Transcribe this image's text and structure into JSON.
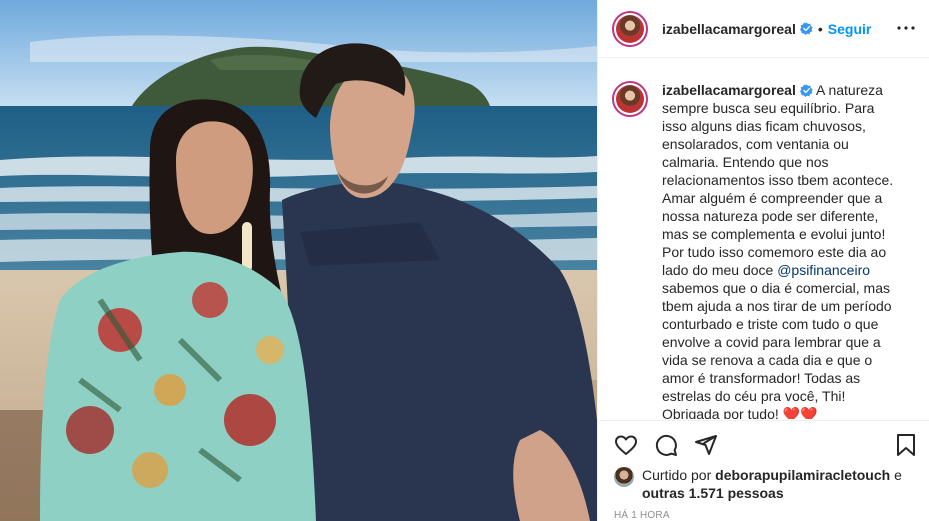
{
  "post": {
    "username": "izabellacamargoreal",
    "verified_icon": "verified-badge-icon",
    "follow_label": "Seguir",
    "dot": "•",
    "caption": "A natureza sempre busca seu equilíbrio. Para isso alguns dias ficam chuvosos, ensolarados, com ventania ou calmaria. Entendo que nos relacionamentos isso tbem acontece. Amar alguém é compreender que a nossa natureza pode ser diferente, mas se complementa e evolui junto! Por tudo isso comemoro este dia ao lado do meu doce ",
    "mention": "@psifinanceiro",
    "caption_tail": " sabemos que o dia é comercial, mas tbem ajuda a nos tirar de um período conturbado e triste com tudo o que envolve a covid para lembrar que a vida se renova a cada dia e que o amor é transformador! Todas as estrelas do céu pra você, Thi!\nObrigada por tudo! ",
    "hearts": "❤️❤️"
  },
  "likes": {
    "prefix": "Curtido por ",
    "liker": "deborapupilamiracletouch",
    "mid": " e",
    "others": "outras 1.571 pessoas"
  },
  "timestamp": "HÁ 1 HORA",
  "colors": {
    "accent": "#0095f6",
    "verified": "#3897f0",
    "text": "#262626",
    "muted": "#8e8e8e",
    "mention": "#00376b",
    "heart": "#ed4956"
  },
  "icons": [
    "more-options-icon",
    "like-heart-icon",
    "comment-icon",
    "share-icon",
    "save-bookmark-icon",
    "verified-badge-icon"
  ]
}
